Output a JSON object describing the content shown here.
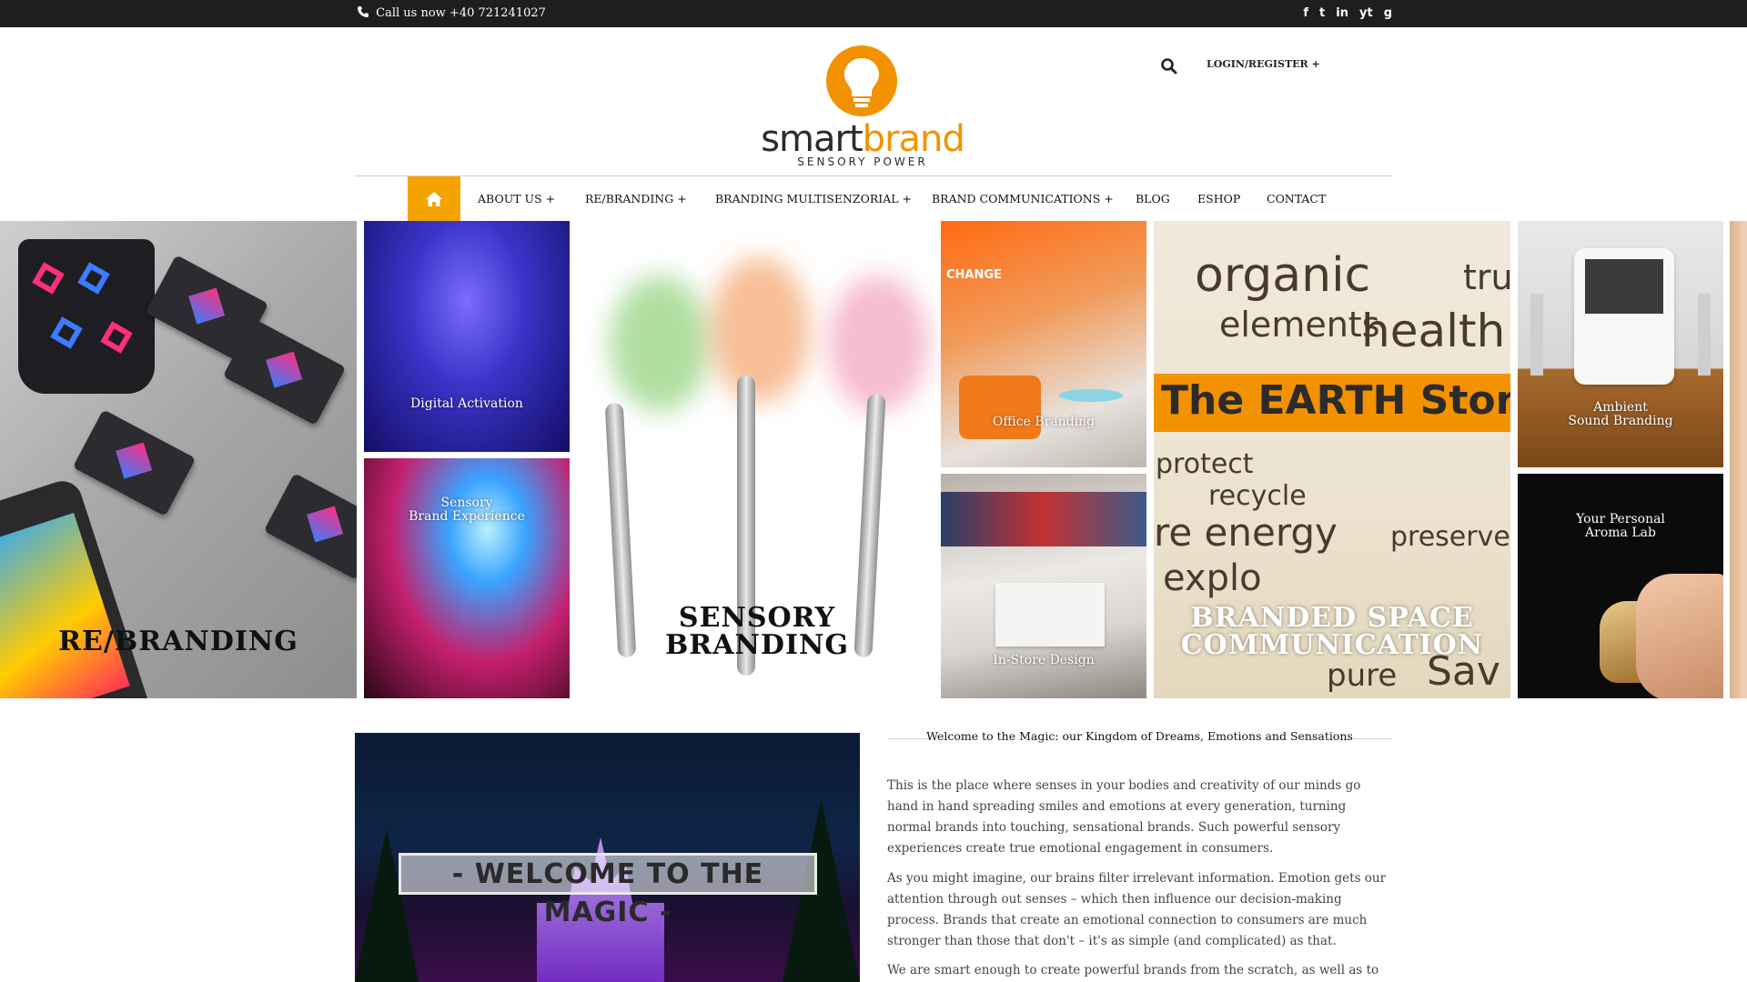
{
  "topbar": {
    "call_text": "Call us now +40 721241027",
    "social": [
      "f",
      "t",
      "in",
      "yt",
      "g"
    ]
  },
  "header": {
    "logo_word_1": "smart",
    "logo_word_2": "brand",
    "logo_tagline": "SENSORY POWER",
    "login_label": "LOGIN/REGISTER +"
  },
  "nav": {
    "items": [
      "ABOUT US +",
      "RE/BRANDING +",
      "BRANDING MULTISENZORIAL +",
      "BRAND COMMUNICATIONS +",
      "BLOG",
      "ESHOP",
      "CONTACT"
    ]
  },
  "hero": {
    "rebranding": "RE/BRANDING",
    "digital_activation": "Digital Activation",
    "sensory_exp_1": "Sensory",
    "sensory_exp_2": "Brand Experience",
    "sensory_1": "SENSORY",
    "sensory_2": "BRANDING",
    "office_branding": "Office Branding",
    "instore_design": "In-Store Design",
    "space_1": "BRANDED SPACE",
    "space_2": "COMMUNICATION",
    "ambient_1": "Ambient",
    "ambient_2": "Sound Branding",
    "aroma_1": "Your Personal",
    "aroma_2": "Aroma Lab",
    "space_words": {
      "organic": "organic",
      "tru": "tru",
      "elements": "elements",
      "health": "health",
      "earth_store": "The EARTH Store",
      "protect": "protect",
      "recycle": "recycle",
      "energy": "re energy",
      "preserve": "preserve",
      "explore": "explo",
      "pure": "pure",
      "save": "Sav",
      "change": "CHANGE"
    }
  },
  "content": {
    "image_sign": "- WELCOME TO THE MAGIC -",
    "heading": "Welcome to the Magic: our Kingdom of Dreams, Emotions and Sensations",
    "p1": "This is the place where senses in your bodies and creativity of our minds go hand in hand spreading smiles and emotions at every generation, turning normal brands into touching, sensational brands. Such powerful sensory experiences create true emotional engagement in consumers.",
    "p2": "As you might imagine, our brains filter irrelevant information. Emotion gets our attention through out senses – which then influence our decision-making process. Brands that create an emotional connection to consumers are much stronger than those that don't – it's as simple (and complicated) as that.",
    "p3": "We are smart enough to create powerful brands from the scratch, as well as to"
  },
  "colors": {
    "accent": "#f39200",
    "home": "#f5a300",
    "topbar": "#1e1e1e"
  }
}
